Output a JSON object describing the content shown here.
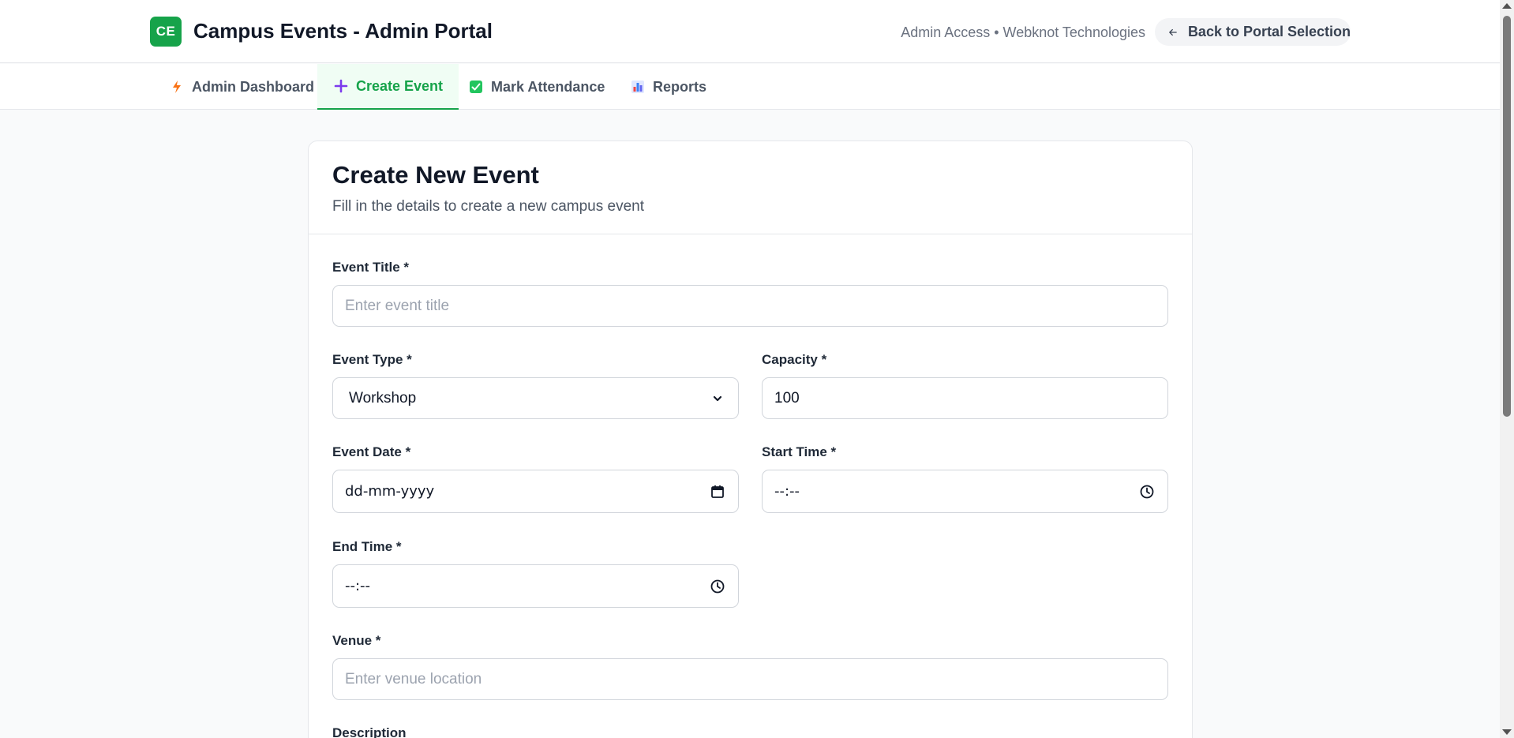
{
  "header": {
    "logo_text": "CE",
    "title": "Campus Events - Admin Portal",
    "access_text": "Admin Access • Webknot Technologies",
    "back_button": "Back to Portal Selection"
  },
  "tabs": [
    {
      "label": "Admin Dashboard",
      "icon": "lightning-icon",
      "active": false
    },
    {
      "label": "Create Event",
      "icon": "plus-icon",
      "active": true
    },
    {
      "label": "Mark Attendance",
      "icon": "checkbox-icon",
      "active": false
    },
    {
      "label": "Reports",
      "icon": "bar-chart-icon",
      "active": false
    }
  ],
  "form": {
    "title": "Create New Event",
    "subtitle": "Fill in the details to create a new campus event",
    "event_title": {
      "label": "Event Title *",
      "placeholder": "Enter event title",
      "value": ""
    },
    "event_type": {
      "label": "Event Type *",
      "value": "Workshop"
    },
    "capacity": {
      "label": "Capacity *",
      "value": "100"
    },
    "event_date": {
      "label": "Event Date *",
      "display": "dd-mm-yyyy"
    },
    "start_time": {
      "label": "Start Time *",
      "display": "--:--"
    },
    "end_time": {
      "label": "End Time *",
      "display": "--:--"
    },
    "venue": {
      "label": "Venue *",
      "placeholder": "Enter venue location",
      "value": ""
    },
    "description": {
      "label": "Description"
    }
  },
  "colors": {
    "brand": "#16a34a",
    "active_tab_bg": "#f0fdf4",
    "page_bg": "#f9fafb",
    "border": "#d1d5db"
  }
}
